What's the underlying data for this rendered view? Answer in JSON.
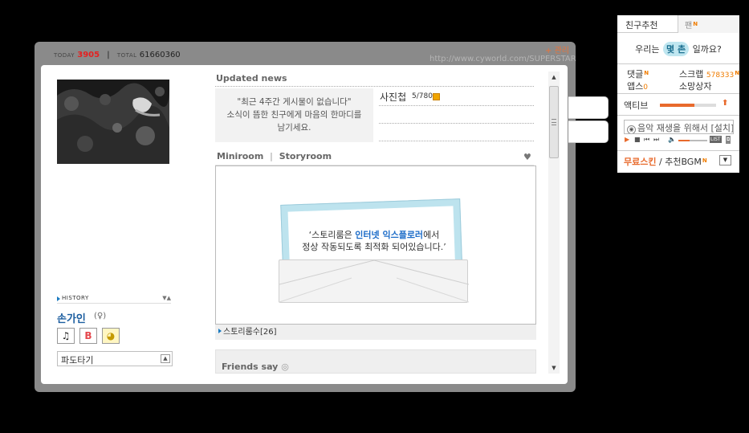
{
  "visitor": {
    "today_label": "TODAY",
    "today_value": "3905",
    "total_label": "TOTAL",
    "total_value": "61660360"
  },
  "header": {
    "settings_label": "+ 관리",
    "homepage_url": "http://www.cyworld.com/SUPERSTAR"
  },
  "profile": {
    "history_label": "HISTORY",
    "name": "손가인",
    "gender": "(♀)",
    "badges": [
      "music-note",
      "b",
      "pikachu"
    ],
    "wave_label": "파도타기"
  },
  "news": {
    "title": "Updated news",
    "message_line1": "\"최근 4주간 게시물이 없습니다\"",
    "message_line2": "소식이 뜸한 친구에게 마음의 한마디를",
    "message_line3": "남기세요.",
    "photo_label": "사진첩",
    "photo_count": "5/780"
  },
  "miniroom": {
    "tab_miniroom": "Miniroom",
    "separator": "|",
    "tab_storyroom": "Storyroom",
    "notice_part1": "‘스토리룸은 ",
    "notice_highlight": "인터넷 익스플로러",
    "notice_part2": "에서",
    "notice_line2": "정상 작동되도록 최적화 되어있습니다.’",
    "storyroom_count_label": "스토리룸수",
    "storyroom_count": "[26]"
  },
  "friends": {
    "title": "Friends say"
  },
  "panel": {
    "tab_friend_recommend": "친구추천",
    "tab_fan": "팬",
    "greeting_before": "우리는",
    "greeting_pill": "몇 촌",
    "greeting_after": "일까요?",
    "comments_label": "댓글",
    "scrap_label": "스크랩",
    "scrap_value": "578333",
    "apps_label": "앱스",
    "apps_value": "0",
    "wish_label": "소망상자",
    "active_label": "액티브",
    "active_level": 0.62,
    "music_notice": "음악 재생을 위해서 [설치]",
    "list_label": "LIST",
    "free_skin": "무료스킨",
    "recommend_bgm": "추천BGM",
    "colors": {
      "accent": "#f07c00",
      "link": "#1c5ea0"
    }
  }
}
